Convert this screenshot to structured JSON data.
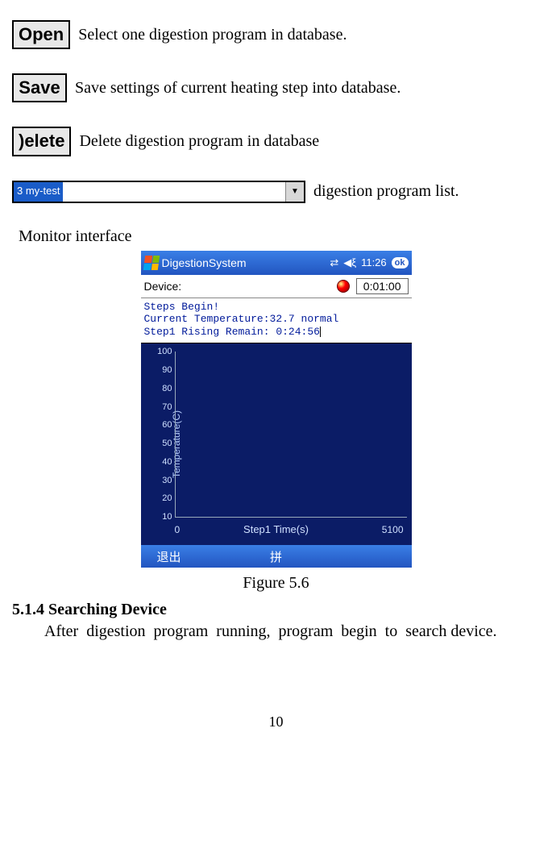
{
  "buttons": {
    "open": {
      "label": "Open",
      "desc": "Select one digestion program in database."
    },
    "save": {
      "label": "Save",
      "desc": "Save settings of current heating step into database."
    },
    "delete": {
      "label": ")eletе",
      "desc": "Delete digestion program in database"
    }
  },
  "combo": {
    "selected": "3 my-test",
    "desc": "digestion program list."
  },
  "monitor_heading": "Monitor interface",
  "screenshot": {
    "title": "DigestionSystem",
    "clock": "11:26",
    "ok": "ok",
    "device_label": "Device:",
    "timer": "0:01:00",
    "msgs": {
      "line1": "Steps Begin!",
      "line2": "Current Temperature:32.7 normal",
      "line3": "Step1 Rising Remain: 0:24:56"
    },
    "softkey_left": "退出",
    "softkey_center": "拼"
  },
  "chart_data": {
    "type": "line",
    "title": "",
    "xlabel": "Step1 Time(s)",
    "ylabel": "Temperature(C)",
    "x_ticks": [
      "0",
      "5100"
    ],
    "y_ticks": [
      "10",
      "20",
      "30",
      "40",
      "50",
      "60",
      "70",
      "80",
      "90",
      "100"
    ],
    "ylim": [
      0,
      100
    ],
    "xlim": [
      0,
      5100
    ],
    "series": []
  },
  "caption": "Figure 5.6",
  "section_title": "5.1.4 Searching Device",
  "section_para": "After digestion program running, program begin to search device.",
  "page_number": "10"
}
